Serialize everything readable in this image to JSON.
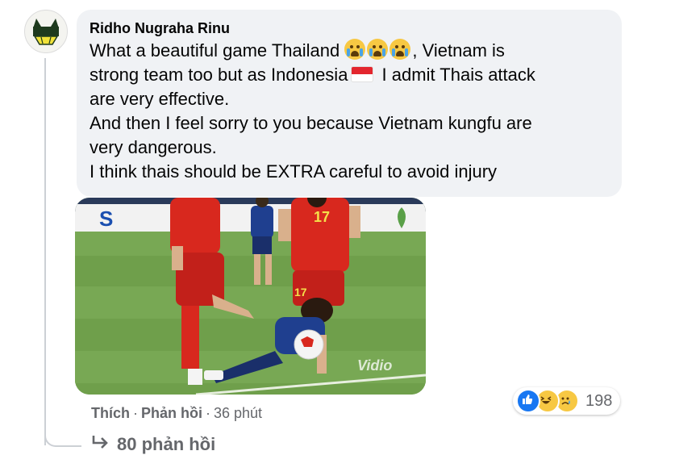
{
  "comment": {
    "author": "Ridho Nugraha Rinu",
    "lines": [
      "What a beautiful game Thailand",
      ", Vietnam is",
      "strong team too but as Indonesia",
      " I admit Thais attack",
      "are very effective.",
      "And then I feel sorry to you because Vietnam kungfu are",
      "very dangerous.",
      "I think thais should be EXTRA careful to avoid injury"
    ],
    "emojis": [
      "loudly-crying-face",
      "loudly-crying-face",
      "loudly-crying-face"
    ],
    "flag": "indonesia-flag"
  },
  "photo": {
    "watermark": "Vidio",
    "jersey_number": "17",
    "ad_letters": "S",
    "colors": {
      "pitch": "#6f9f4b",
      "red_kit": "#d8281e",
      "blue_kit": "#1f3f8f"
    }
  },
  "actions": {
    "like": "Thích",
    "reply": "Phản hồi",
    "separator": "·",
    "time": "36 phút"
  },
  "reactions": {
    "icons": [
      "like-icon",
      "haha-icon",
      "sad-icon"
    ],
    "count": "198"
  },
  "replies": {
    "label": "80 phản hồi"
  },
  "colors": {
    "bubble": "#f0f2f5",
    "secondary_text": "#65676b",
    "like_blue": "#1877f2"
  }
}
